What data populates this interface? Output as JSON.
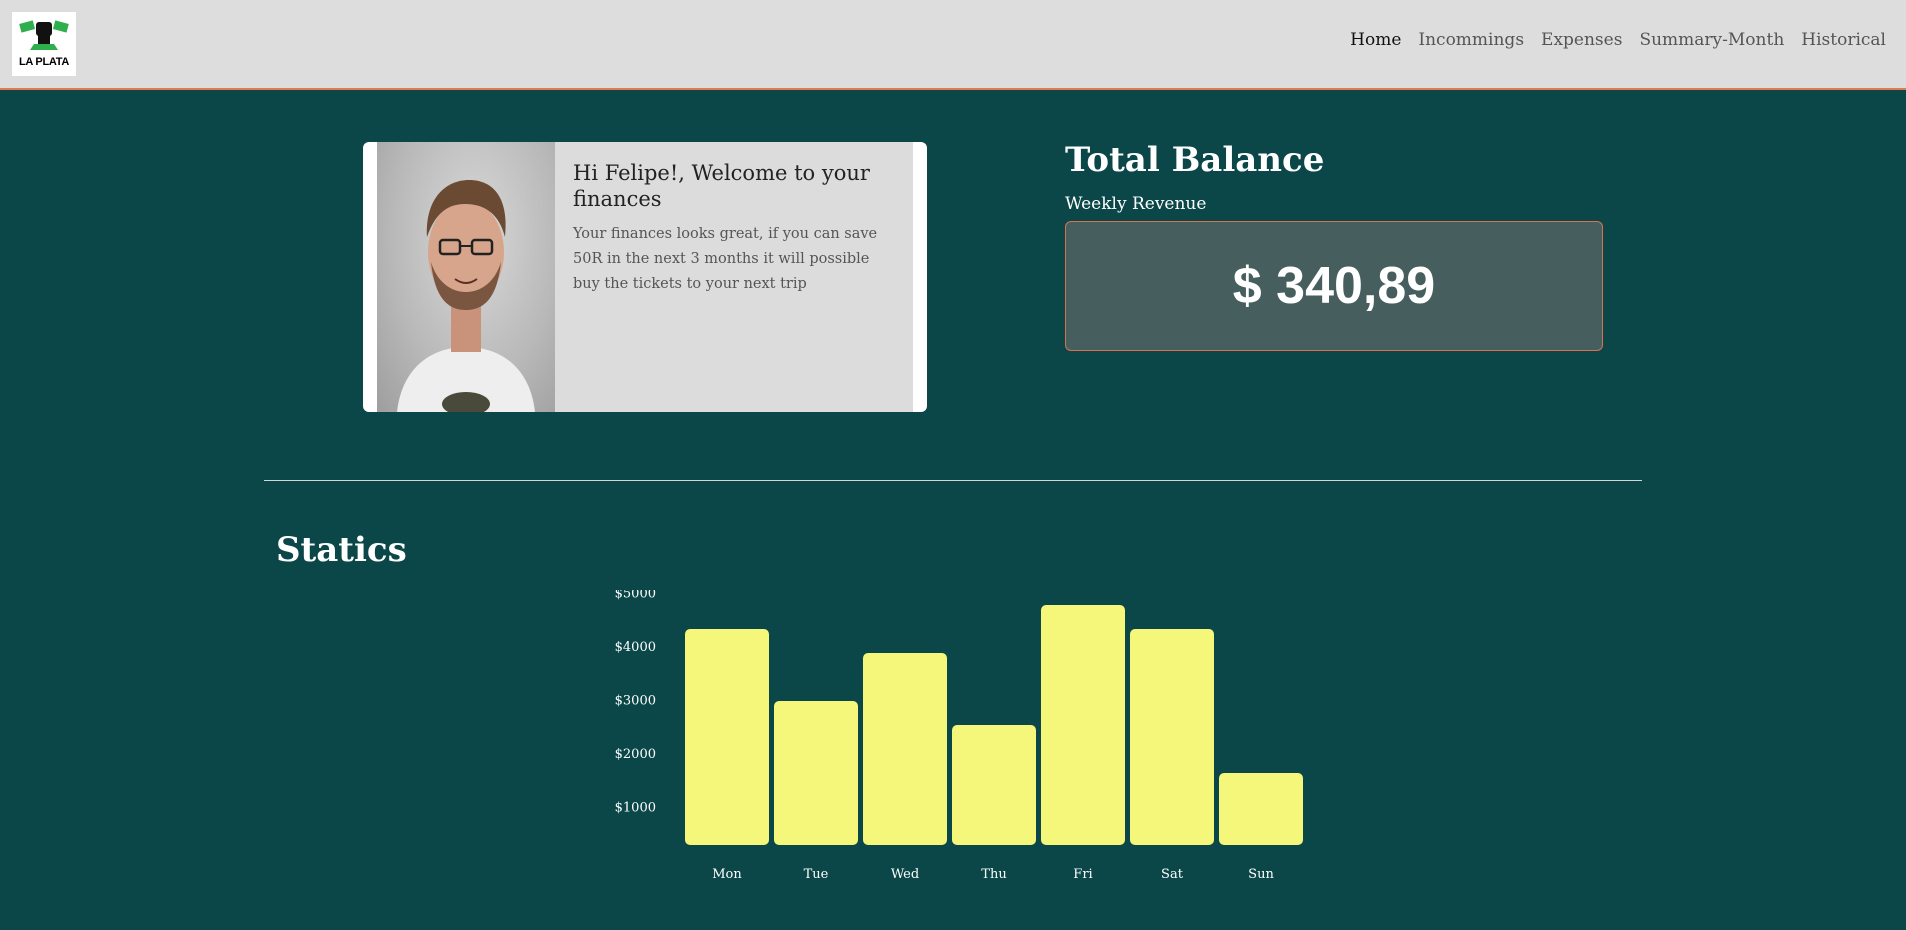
{
  "header": {
    "logo_text": "LA PLATA",
    "nav": [
      {
        "label": "Home",
        "active": true
      },
      {
        "label": "Incommings",
        "active": false
      },
      {
        "label": "Expenses",
        "active": false
      },
      {
        "label": "Summary-Month",
        "active": false
      },
      {
        "label": "Historical",
        "active": false
      }
    ]
  },
  "welcome": {
    "title": "Hi Felipe!, Welcome to your finances",
    "text": "Your finances looks great, if you can save 50R in the next 3 months it will possible buy the tickets to your next trip"
  },
  "balance": {
    "title": "Total Balance",
    "subtitle": "Weekly Revenue",
    "value": "$ 340,89"
  },
  "statics": {
    "title": "Statics"
  },
  "colors": {
    "background": "#0b4749",
    "header": "#dddddd",
    "accent": "#e07a52",
    "bar": "#f5f77a",
    "balance_box": "#465f5e"
  },
  "chart_data": {
    "type": "bar",
    "categories": [
      "Mon",
      "Tue",
      "Wed",
      "Thu",
      "Fri",
      "Sat",
      "Sun"
    ],
    "values": [
      4500,
      3000,
      4000,
      2500,
      5000,
      4500,
      1500
    ],
    "yticks": [
      "$1000",
      "$2000",
      "$3000",
      "$4000",
      "$5000"
    ],
    "ytick_values": [
      1000,
      2000,
      3000,
      4000,
      5000
    ],
    "ylim": [
      0,
      5000
    ],
    "grid": false,
    "title": "",
    "xlabel": "",
    "ylabel": ""
  }
}
